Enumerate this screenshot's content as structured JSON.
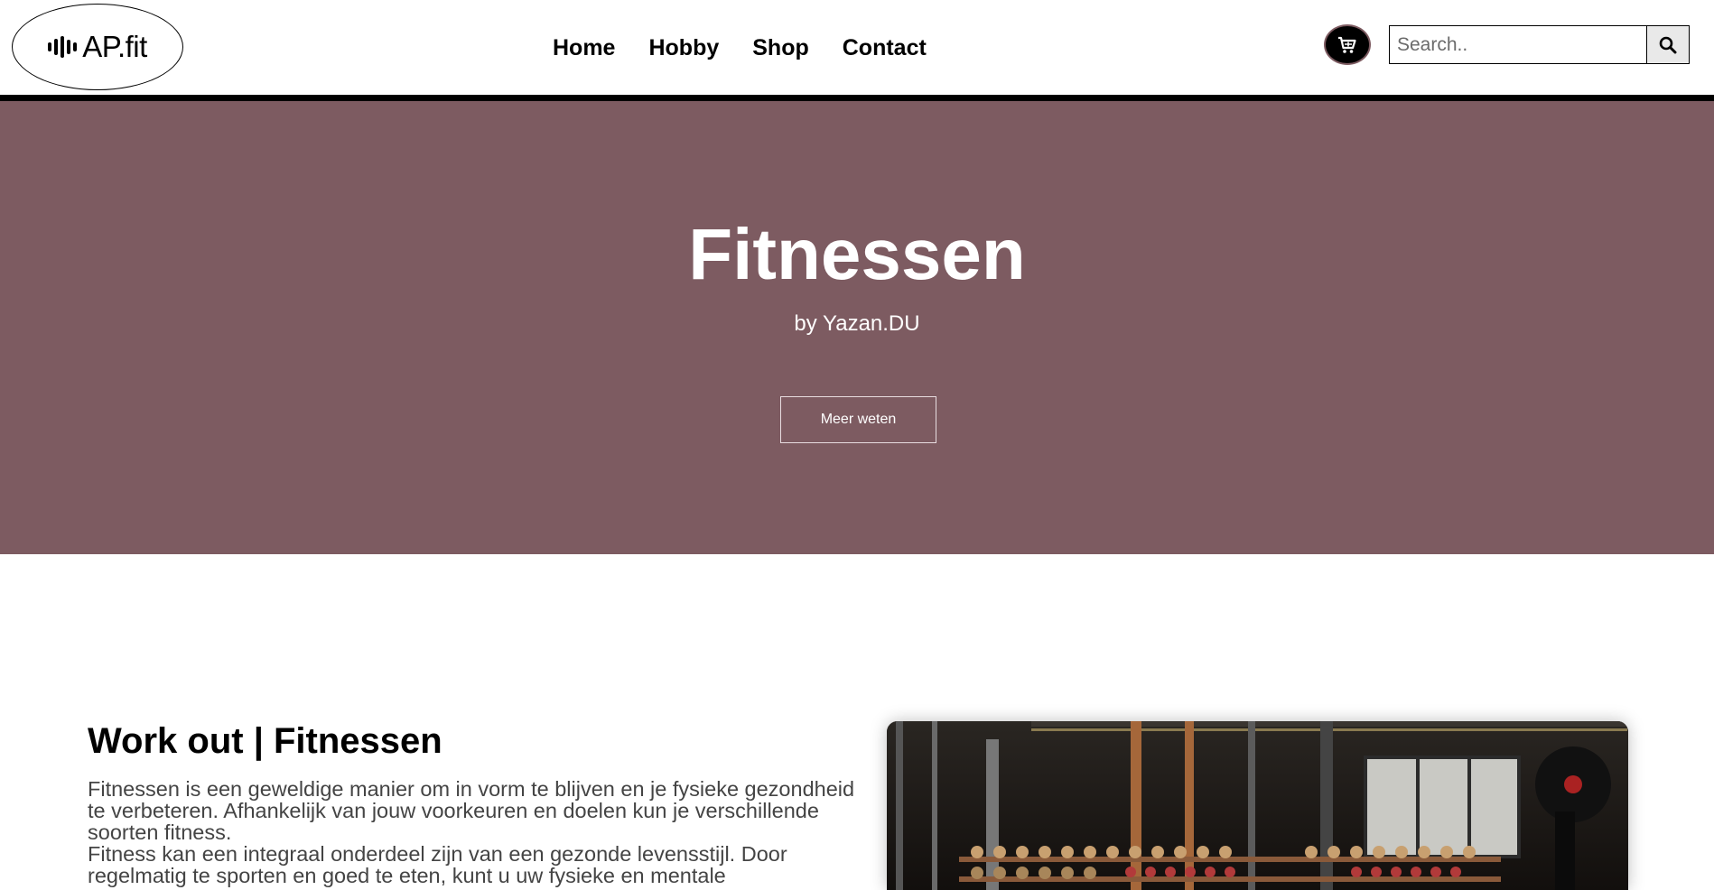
{
  "header": {
    "logo_text": "AP.fit",
    "nav": [
      {
        "label": "Home"
      },
      {
        "label": "Hobby"
      },
      {
        "label": "Shop"
      },
      {
        "label": "Contact"
      }
    ],
    "cart_icon": "cart-icon",
    "search": {
      "placeholder": "Search..",
      "button_icon": "search-icon"
    }
  },
  "hero": {
    "title": "Fitnessen",
    "subtitle": "by Yazan.DU",
    "button_label": "Meer weten",
    "background_color": "#7d5b61"
  },
  "content": {
    "title": "Work out | Fitnessen",
    "paragraphs": [
      "Fitnessen is een geweldige manier om in vorm te blijven en je fysieke gezondheid te verbeteren. Afhankelijk van jouw voorkeuren en doelen kun je verschillende soorten fitness.",
      "Fitness kan een integraal onderdeel zijn van een gezonde levensstijl. Door regelmatig te sporten en goed te eten, kunt u uw fysieke en mentale"
    ],
    "image_alt": "gym-photo"
  }
}
